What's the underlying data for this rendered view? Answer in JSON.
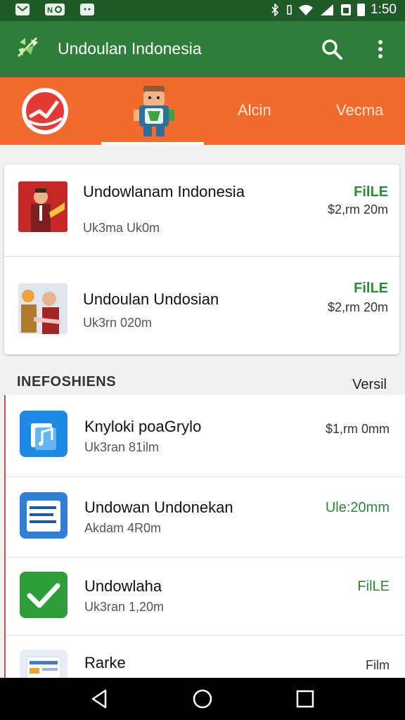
{
  "status_bar": {
    "time": "1:50",
    "left_icons": [
      "mail-icon",
      "nfc-icon",
      "android-icon"
    ],
    "right_icons": [
      "bluetooth-icon",
      "vibrate-icon",
      "wifi-icon",
      "signal-icon",
      "sim-icon",
      "battery-icon"
    ]
  },
  "app_bar": {
    "title": "Undoulan Indonesia",
    "color": "#2e7d3a",
    "search_icon": "search-icon",
    "more_icon": "more-vert-icon"
  },
  "tabs": {
    "color": "#f06b2d",
    "items": [
      {
        "icon": "chart-badge-icon"
      },
      {
        "icon": "character-icon",
        "selected": true
      },
      {
        "label": "Alcin"
      },
      {
        "label": "Vecma"
      }
    ]
  },
  "featured": [
    {
      "title": "Undowlanam Indonesia",
      "subtitle": "Uk3ma Uk0m",
      "status": "FilLE",
      "price": "$2,rm 20m",
      "thumb": "person-flag-thumbnail"
    },
    {
      "title": "Undoulan Undosian",
      "subtitle": "Uk3rn 020m",
      "status": "FilLE",
      "price": "$2,rm 20m",
      "thumb": "person-altar-thumbnail"
    }
  ],
  "section": {
    "title": "INEFOSHIENS",
    "action": "Versil"
  },
  "list": [
    {
      "title": "Knyloki poaGrylo",
      "subtitle": "Uk3ran 81ilm",
      "right": "$1,rm 0mm",
      "right_color": "#333333",
      "icon": "music-doc-icon",
      "icon_bg": "#1e88e5"
    },
    {
      "title": "Undowan Undonekan",
      "subtitle": "Akdam 4R0m",
      "right": "Ule:20mm",
      "right_color": "#2c8a34",
      "icon": "document-card-icon",
      "icon_bg": "#2f7fd9"
    },
    {
      "title": "Undowlaha",
      "subtitle": "Uk3ran 1,20m",
      "right": "FilLE",
      "right_color": "#2c8a34",
      "icon": "checkmark-icon",
      "icon_bg": "#2e9e3a"
    },
    {
      "title": "Rarke",
      "subtitle": "",
      "right": "Film",
      "right_color": "#333333",
      "icon": "screen-doc-icon",
      "icon_bg": "#e9eef5"
    }
  ],
  "nav": {
    "back": "back-icon",
    "home": "home-icon",
    "recents": "recents-icon"
  }
}
